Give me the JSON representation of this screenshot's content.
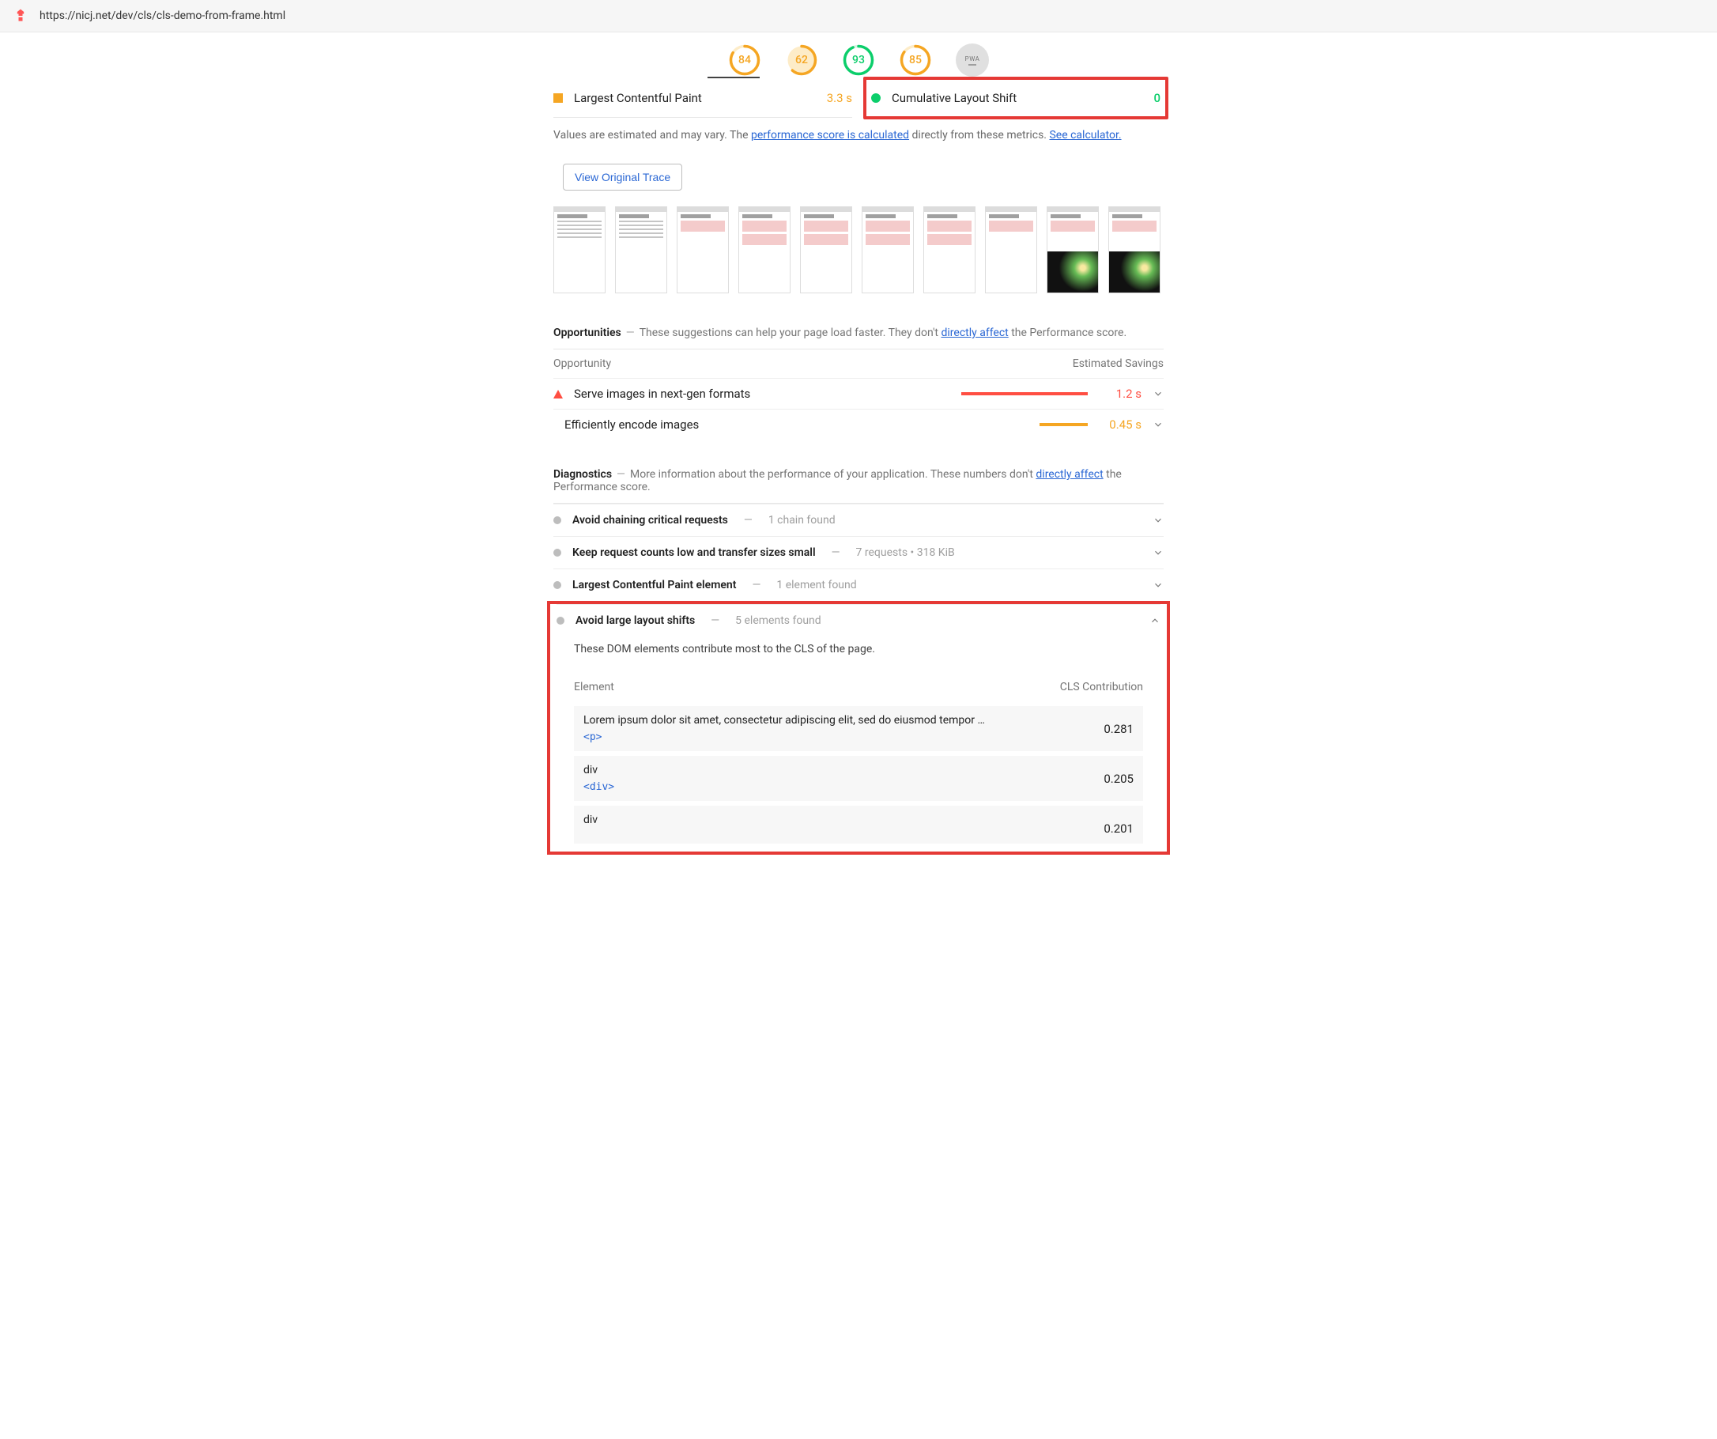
{
  "header": {
    "url": "https://nicj.net/dev/cls/cls-demo-from-frame.html"
  },
  "gauges": [
    {
      "score": 84,
      "color": "#f5a623"
    },
    {
      "score": 62,
      "color": "#f5a623"
    },
    {
      "score": 93,
      "color": "#0cce6b"
    },
    {
      "score": 85,
      "color": "#f5a623"
    }
  ],
  "pwa_label": "PWA",
  "metrics": {
    "lcp": {
      "label": "Largest Contentful Paint",
      "value": "3.3 s"
    },
    "cls": {
      "label": "Cumulative Layout Shift",
      "value": "0"
    }
  },
  "note": {
    "pre": "Values are estimated and may vary. The ",
    "link1": "performance score is calculated",
    "mid": " directly from these metrics. ",
    "link2": "See calculator."
  },
  "view_trace": "View Original Trace",
  "opportunities": {
    "title": "Opportunities",
    "desc_pre": "These suggestions can help your page load faster. They don't ",
    "desc_link": "directly affect",
    "desc_post": " the Performance score.",
    "col1": "Opportunity",
    "col2": "Estimated Savings",
    "rows": [
      {
        "label": "Serve images in next-gen formats",
        "value": "1.2 s",
        "valcls": "val-red",
        "barcls": "red",
        "barw": "100%",
        "icon": "tri"
      },
      {
        "label": "Efficiently encode images",
        "value": "0.45 s",
        "valcls": "val-orange",
        "barcls": "orange",
        "barw": "38%",
        "icon": "sq"
      }
    ]
  },
  "diagnostics": {
    "title": "Diagnostics",
    "desc_pre": "More information about the performance of your application. These numbers don't ",
    "desc_link": "directly affect",
    "desc_post": " the Performance score.",
    "rows": [
      {
        "label": "Avoid chaining critical requests",
        "sub": "1 chain found"
      },
      {
        "label": "Keep request counts low and transfer sizes small",
        "sub": "7 requests • 318 KiB"
      },
      {
        "label": "Largest Contentful Paint element",
        "sub": "1 element found"
      }
    ],
    "expanded": {
      "label": "Avoid large layout shifts",
      "sub": "5 elements found",
      "desc": "These DOM elements contribute most to the CLS of the page.",
      "col1": "Element",
      "col2": "CLS Contribution",
      "rows": [
        {
          "text": "Lorem ipsum dolor sit amet, consectetur adipiscing elit, sed do eiusmod tempor …",
          "code": "<p>",
          "val": "0.281"
        },
        {
          "text": "div",
          "code": "<div>",
          "val": "0.205"
        },
        {
          "text": "div",
          "code": "",
          "val": "0.201"
        }
      ]
    }
  },
  "chart_data": {
    "type": "table",
    "gauge_scores": [
      84,
      62,
      93,
      85
    ],
    "metrics": {
      "Largest Contentful Paint": "3.3 s",
      "Cumulative Layout Shift": 0
    },
    "opportunities": [
      {
        "name": "Serve images in next-gen formats",
        "savings_s": 1.2
      },
      {
        "name": "Efficiently encode images",
        "savings_s": 0.45
      }
    ],
    "cls_contributions": [
      {
        "element": "<p>",
        "value": 0.281
      },
      {
        "element": "<div>",
        "value": 0.205
      },
      {
        "element": "div",
        "value": 0.201
      }
    ]
  }
}
